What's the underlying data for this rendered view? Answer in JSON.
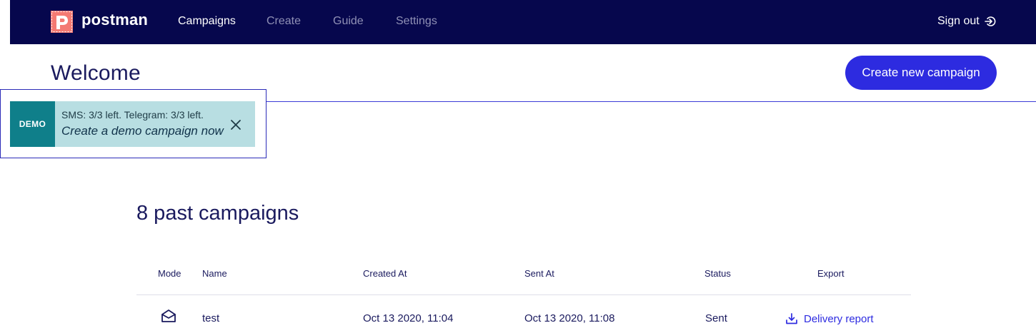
{
  "navbar": {
    "brand": "postman",
    "items": [
      {
        "label": "Campaigns",
        "active": true
      },
      {
        "label": "Create",
        "active": false
      },
      {
        "label": "Guide",
        "active": false
      },
      {
        "label": "Settings",
        "active": false
      }
    ],
    "sign_out_label": "Sign out"
  },
  "header": {
    "title": "Welcome",
    "create_button_label": "Create new campaign"
  },
  "demo_banner": {
    "tag": "DEMO",
    "quota_text": "SMS: 3/3 left. Telegram: 3/3 left.",
    "cta_text": "Create a demo campaign now"
  },
  "campaigns": {
    "title": "8 past campaigns",
    "columns": [
      "Mode",
      "Name",
      "Created At",
      "Sent At",
      "Status",
      "Export"
    ],
    "rows": [
      {
        "mode_icon": "envelope-open-icon",
        "name": "test",
        "created_at": "Oct 13 2020, 11:04",
        "sent_at": "Oct 13 2020, 11:08",
        "status": "Sent",
        "export_label": "Delivery report"
      }
    ]
  },
  "colors": {
    "navbar_bg": "#06074d",
    "primary": "#2d2be0",
    "demo_tag": "#0f7f8a",
    "demo_bg": "#b8dee2"
  }
}
